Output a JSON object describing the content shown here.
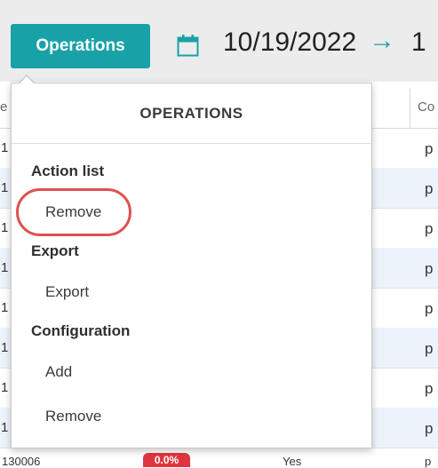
{
  "toolbar": {
    "operations_button": "Operations",
    "start_date": "10/19/2022",
    "arrow": "→",
    "end_date_partial": "1"
  },
  "grid": {
    "header_left": "e",
    "header_right": "Co",
    "rows": [
      {
        "left": "1",
        "right": "p"
      },
      {
        "left": "1",
        "right": "p"
      },
      {
        "left": "1",
        "right": "p"
      },
      {
        "left": "1",
        "right": "p"
      },
      {
        "left": "1",
        "right": "p"
      },
      {
        "left": "1",
        "right": "p"
      },
      {
        "left": "1",
        "right": "p"
      },
      {
        "left": "1",
        "right": "p"
      }
    ],
    "bottom_row": {
      "id": "130006",
      "badge": "0.0%",
      "flag": "Yes",
      "right": "p"
    }
  },
  "dropdown": {
    "title": "OPERATIONS",
    "sections": [
      {
        "label": "Action list",
        "items": [
          "Remove"
        ]
      },
      {
        "label": "Export",
        "items": [
          "Export"
        ]
      },
      {
        "label": "Configuration",
        "items": [
          "Add",
          "Remove"
        ]
      }
    ]
  },
  "colors": {
    "accent": "#19a1a8",
    "highlight": "#e05050",
    "badge": "#e03540",
    "alt_row": "#edf3fb"
  }
}
